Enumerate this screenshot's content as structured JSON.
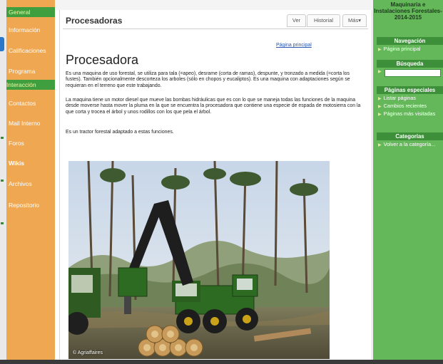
{
  "left_nav": {
    "items": [
      {
        "label": "General",
        "style": "header"
      },
      {
        "label": "Información"
      },
      {
        "label": "Calificaciones"
      },
      {
        "label": "Programa"
      },
      {
        "label": "Interacción",
        "style": "header"
      },
      {
        "label": "Contactos"
      },
      {
        "label": "Mail Interno"
      },
      {
        "label": "Foros"
      },
      {
        "label": "Wikis",
        "style": "bold"
      },
      {
        "label": "Archivos"
      },
      {
        "label": "Repositorio"
      }
    ]
  },
  "main": {
    "page_header": "Procesadoras",
    "tabs": [
      "Ver",
      "Historial",
      "Más▾"
    ],
    "principal_link": "Página principal",
    "article_title": "Procesadora",
    "paragraphs": [
      "Es una maquina de uso forestal, se utiliza para tala (=apeo), desrame (corta de ramas), despunte, y tronzado a medida (=corta los fustes). También opcionalmente descorteza los arboles (sólo en chopos y eucaliptos). Es una maquina con adaptaciones según se requieran en el terreno que este trabajando.",
      "La maquina tiene un motor diesel que mueve las bombas hidráulicas que es con lo que se maneja todas las funciones de la maquina desde moverse hasta mover la pluma en la que se encuentra la procesadora que contiene una especie de espada de motosierra con la que corta y trocea el árbol y unos rodillos con los que pela el árbol.",
      "Es un tractor forestal adaptado a estas funciones."
    ],
    "photo_caption": "© Agriaffaires"
  },
  "right_sidebar": {
    "site_title": "Maquinaria e Instalaciones Forestales-2014-2015",
    "nav_heading": "Navegación",
    "nav_links": [
      "Página principal"
    ],
    "search_heading": "Búsqueda",
    "special_heading": "Páginas especiales",
    "special_links": [
      "Listar páginas",
      "Cambios recientes",
      "Páginas más visitadas"
    ],
    "categories_heading": "Categorías",
    "categories_links": [
      "Volver a la categoría..."
    ]
  },
  "colors": {
    "nav_orange": "#f0a752",
    "nav_header_green": "#3f9f3f",
    "sidebar_green": "#64b85a",
    "link_blue": "#2a55b0"
  }
}
